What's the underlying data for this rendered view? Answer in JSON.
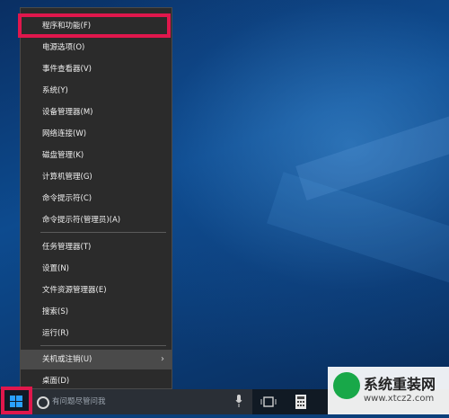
{
  "menu": {
    "items": [
      {
        "label": "程序和功能(F)"
      },
      {
        "label": "电源选项(O)"
      },
      {
        "label": "事件查看器(V)"
      },
      {
        "label": "系统(Y)"
      },
      {
        "label": "设备管理器(M)"
      },
      {
        "label": "网络连接(W)"
      },
      {
        "label": "磁盘管理(K)"
      },
      {
        "label": "计算机管理(G)"
      },
      {
        "label": "命令提示符(C)"
      },
      {
        "label": "命令提示符(管理员)(A)"
      },
      {
        "label": "任务管理器(T)"
      },
      {
        "label": "设置(N)"
      },
      {
        "label": "文件资源管理器(E)"
      },
      {
        "label": "搜索(S)"
      },
      {
        "label": "运行(R)"
      },
      {
        "label": "关机或注销(U)"
      },
      {
        "label": "桌面(D)"
      }
    ]
  },
  "taskbar": {
    "search_placeholder": "有问题尽管问我"
  },
  "watermark": {
    "title": "系统重装网",
    "url": "www.xtcz2.com"
  },
  "colors": {
    "menu_bg": "#2b2b2b",
    "highlight": "#e0174c",
    "taskbar": "#111a24"
  }
}
